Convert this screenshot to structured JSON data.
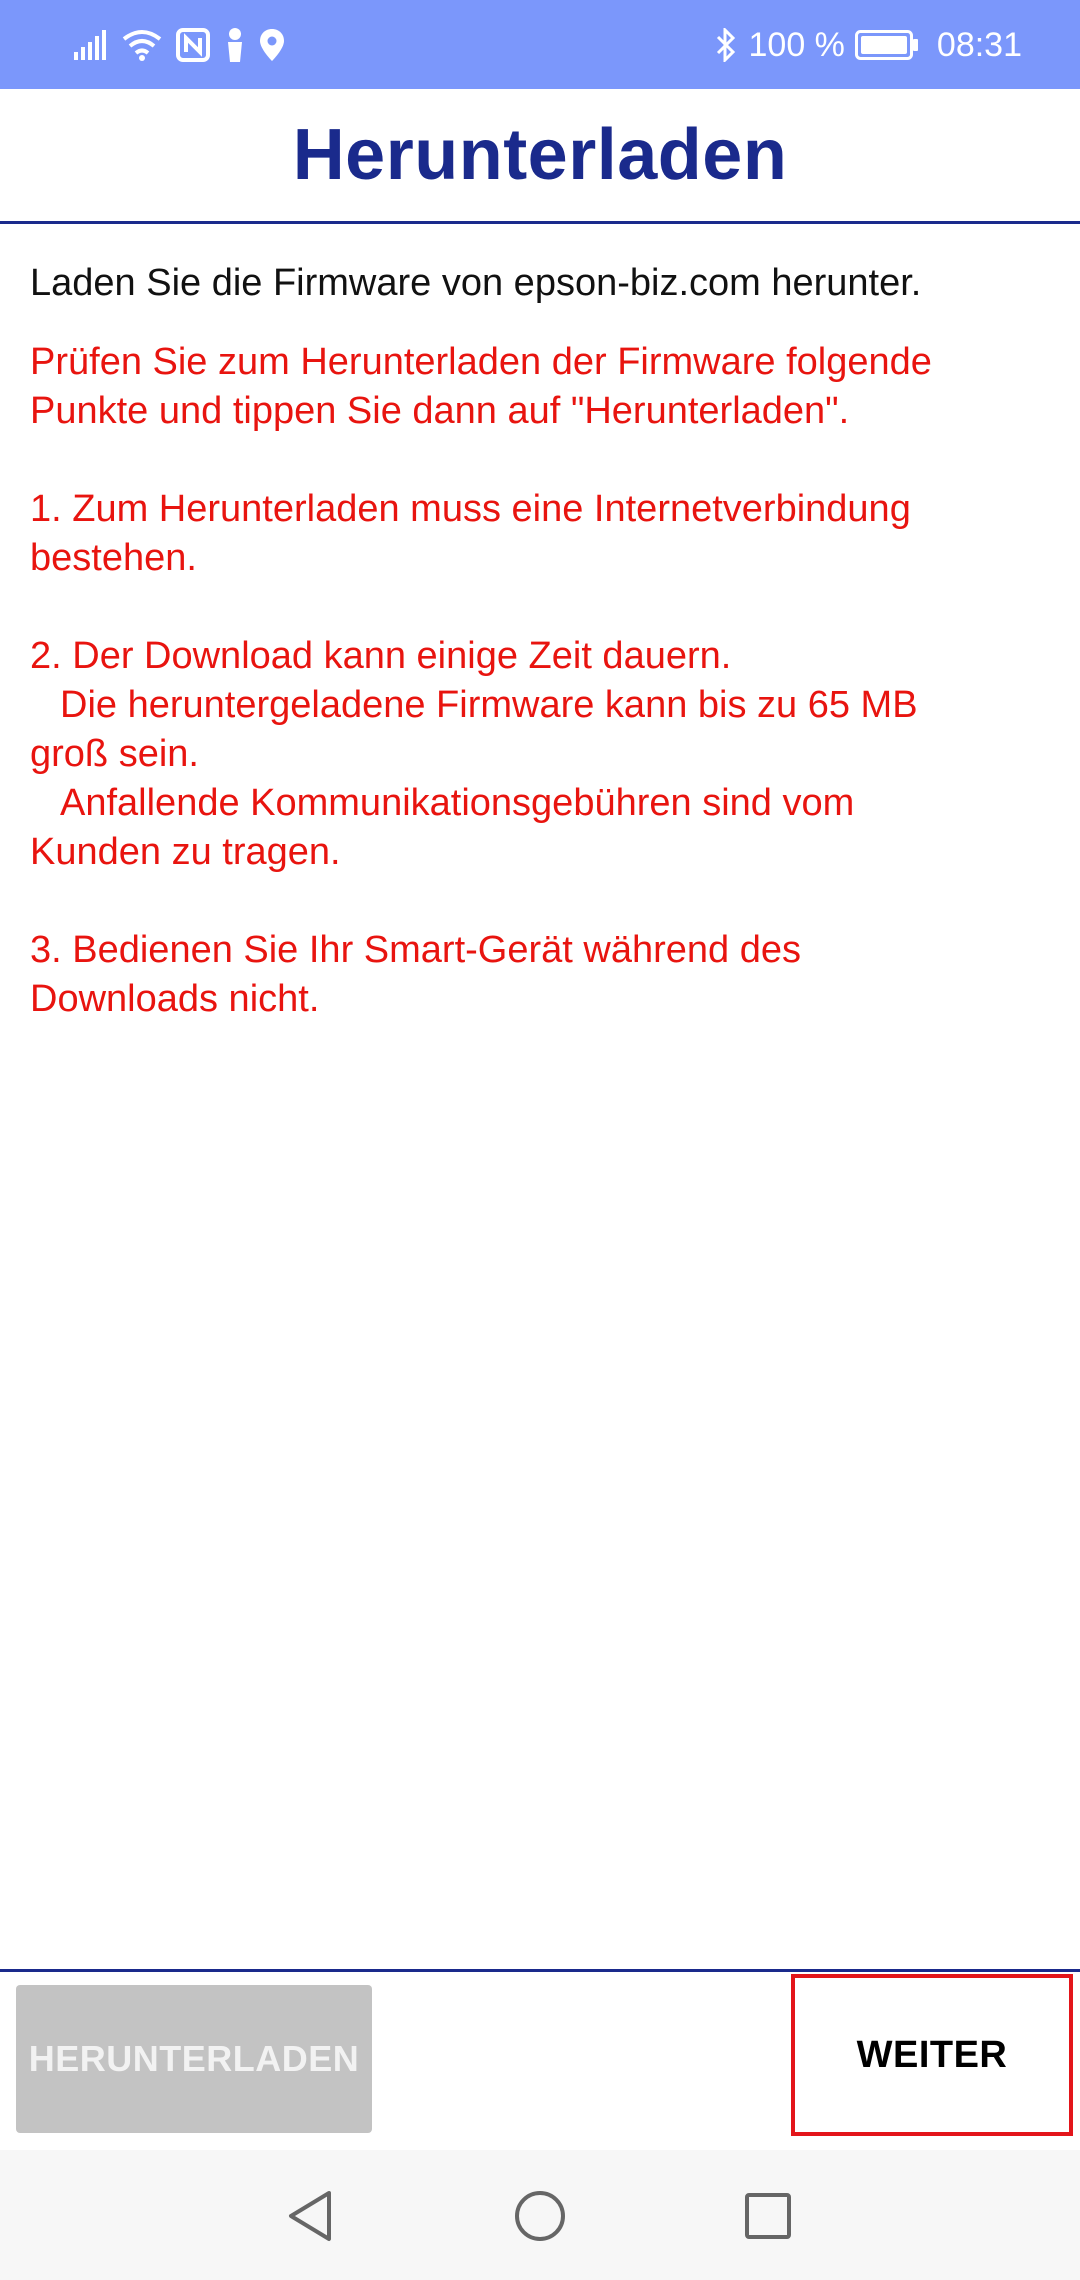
{
  "status_bar": {
    "battery_percent": "100 %",
    "time": "08:31",
    "icons": [
      "signal-icon",
      "wifi-icon",
      "nfc-icon",
      "person-icon",
      "location-icon",
      "bluetooth-icon",
      "battery-icon"
    ]
  },
  "header": {
    "title": "Herunterladen"
  },
  "main": {
    "intro": "Laden Sie die Firmware von epson-biz.com herunter.",
    "notes": {
      "check_line1": "Prüfen Sie zum Herunterladen der Firmware folgende",
      "check_line2": "Punkte und tippen Sie dann auf \"Herunterladen\".",
      "item1_line1": "1. Zum Herunterladen muss eine Internetverbindung",
      "item1_line2": "bestehen.",
      "item2_line1": "2. Der Download kann einige Zeit dauern.",
      "item2_line2": "Die heruntergeladene Firmware kann bis zu 65 MB",
      "item2_line3": "groß sein.",
      "item2_line4": "Anfallende Kommunikationsgebühren sind vom",
      "item2_line5": "Kunden zu tragen.",
      "item3_line1": "3. Bedienen Sie Ihr Smart-Gerät während des",
      "item3_line2": "Downloads nicht."
    }
  },
  "footer": {
    "download_label": "HERUNTERLADEN",
    "next_label": "WEITER"
  },
  "nav_bar": {
    "icons": [
      "back-icon",
      "home-icon",
      "recents-icon"
    ]
  },
  "colors": {
    "status_bar": "#7b97fb",
    "title": "#1a2a8c",
    "note_text": "#e8140f",
    "highlight_border": "#e3151a",
    "disabled_button": "#c3c3c3"
  }
}
